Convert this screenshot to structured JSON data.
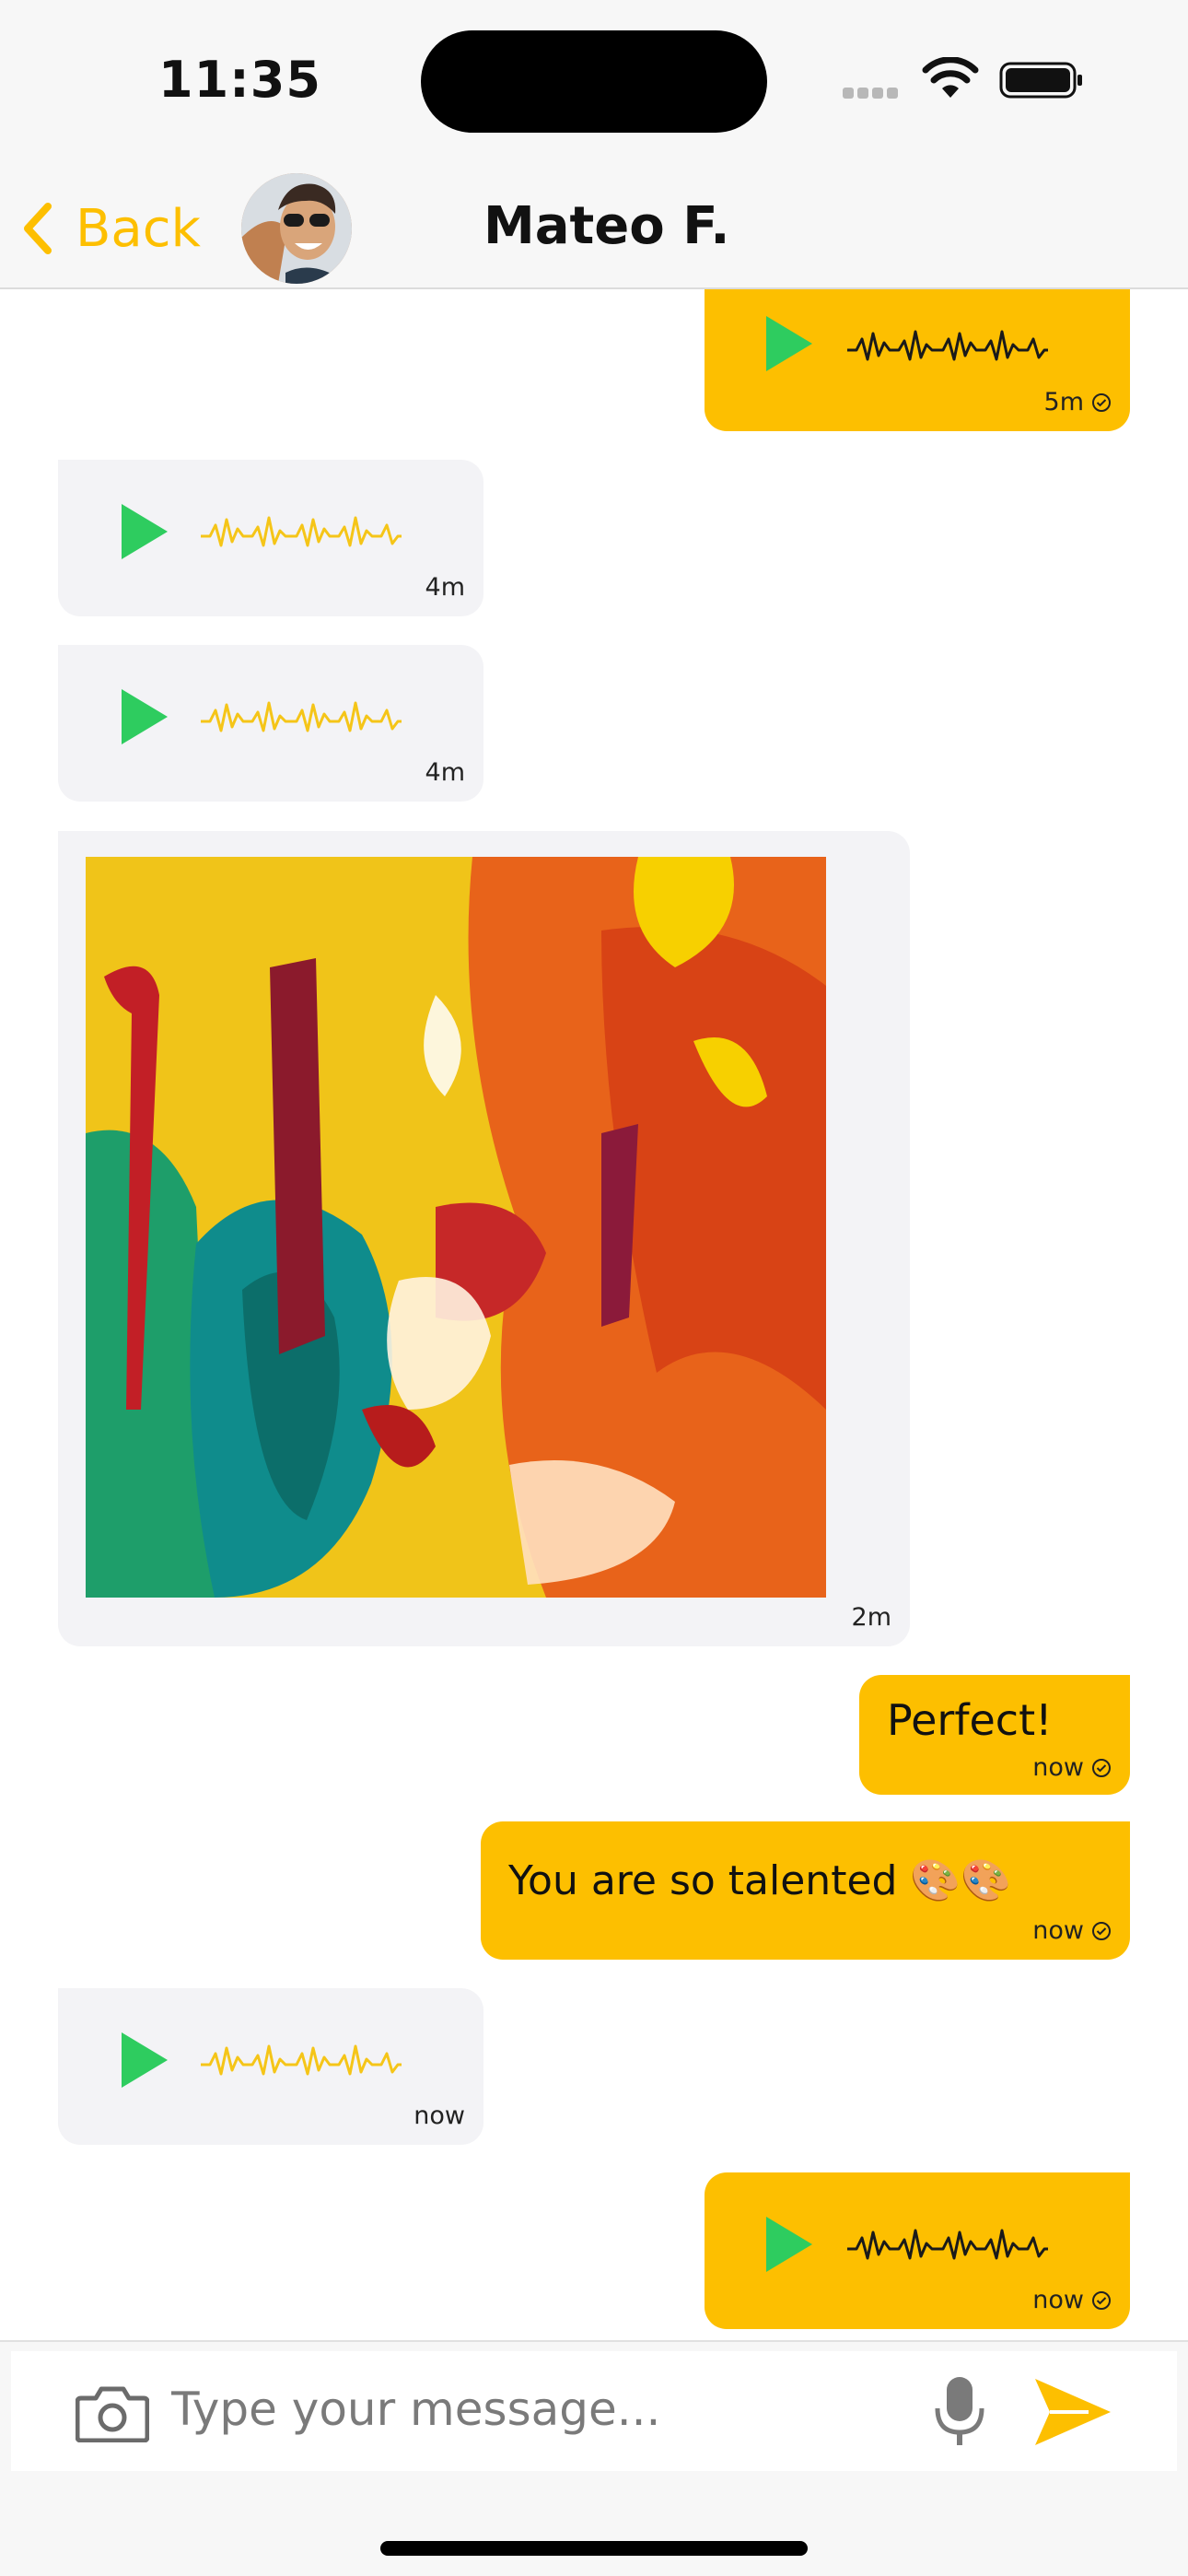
{
  "status_bar": {
    "time": "11:35"
  },
  "header": {
    "back_label": "Back",
    "contact_name": "Mateo F."
  },
  "messages": [
    {
      "type": "voice",
      "direction": "outgoing",
      "time": "5m",
      "read": true
    },
    {
      "type": "voice",
      "direction": "incoming",
      "time": "4m"
    },
    {
      "type": "voice",
      "direction": "incoming",
      "time": "4m"
    },
    {
      "type": "image",
      "direction": "incoming",
      "time": "2m"
    },
    {
      "type": "text",
      "direction": "outgoing",
      "text": "Perfect!",
      "time": "now",
      "read": true
    },
    {
      "type": "text",
      "direction": "outgoing",
      "text": "You are so talented 🎨🎨",
      "time": "now",
      "read": true
    },
    {
      "type": "voice",
      "direction": "incoming",
      "time": "now"
    },
    {
      "type": "voice",
      "direction": "outgoing",
      "time": "now",
      "read": true
    }
  ],
  "composer": {
    "placeholder": "Type your message..."
  },
  "colors": {
    "accent": "#fdbf00",
    "play": "#2ecc5f",
    "incoming_bubble": "#f3f3f6",
    "outgoing_bubble": "#fdbf00"
  }
}
